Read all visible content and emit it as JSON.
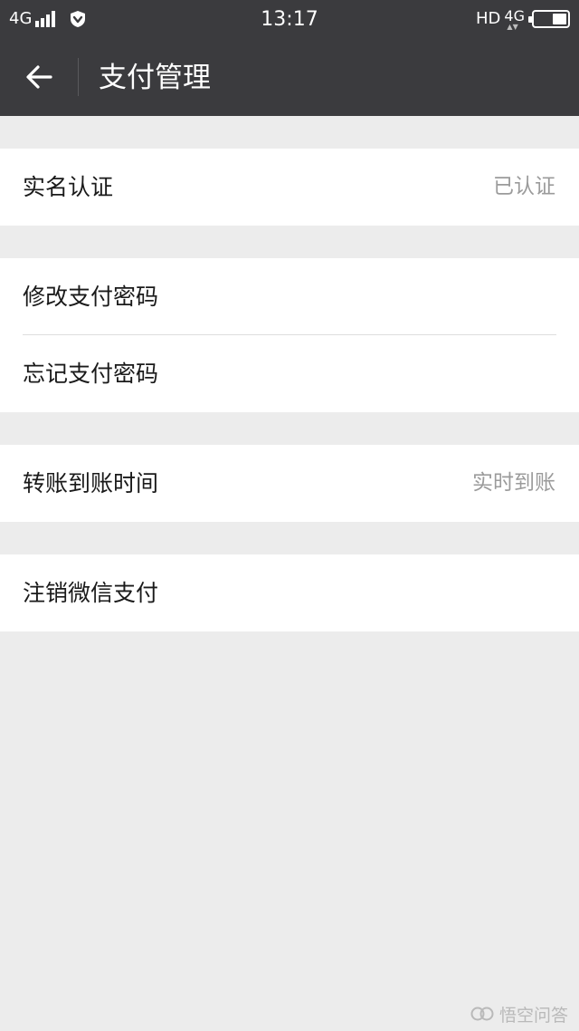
{
  "status_bar": {
    "network_left": "4G",
    "time": "13:17",
    "hd": "HD",
    "network_right": "4G",
    "battery_level": 0.45
  },
  "nav": {
    "title": "支付管理",
    "back_icon": "arrow-left-icon"
  },
  "sections": {
    "verification": {
      "label": "实名认证",
      "value": "已认证"
    },
    "change_password": {
      "label": "修改支付密码"
    },
    "forget_password": {
      "label": "忘记支付密码"
    },
    "transfer_time": {
      "label": "转账到账时间",
      "value": "实时到账"
    },
    "cancel_pay": {
      "label": "注销微信支付"
    }
  },
  "watermark": {
    "text": "悟空问答"
  },
  "colors": {
    "bar": "#3b3b3e",
    "background": "#ececec",
    "cell": "#ffffff",
    "label": "#1a1a1a",
    "value": "#9b9b9b"
  }
}
